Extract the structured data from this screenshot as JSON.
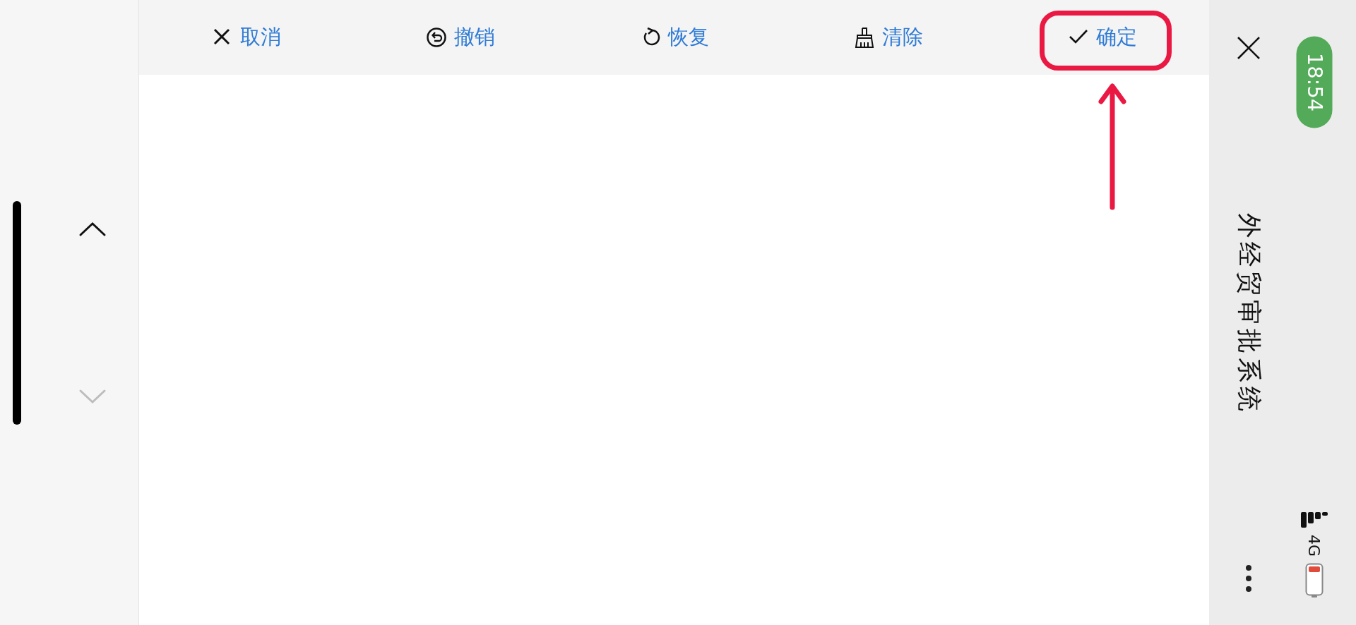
{
  "toolbar": {
    "buttons": [
      {
        "label": "取消"
      },
      {
        "label": "撤销"
      },
      {
        "label": "恢复"
      },
      {
        "label": "清除"
      },
      {
        "label": "确定"
      }
    ]
  },
  "scroll_buttons": [
    {
      "kind": "up",
      "disabled": false
    },
    {
      "kind": "down",
      "disabled": true
    }
  ],
  "title_bar": {
    "title": "外经贸审批系统"
  },
  "status_bar": {
    "time": "18:54",
    "network": "4G"
  }
}
